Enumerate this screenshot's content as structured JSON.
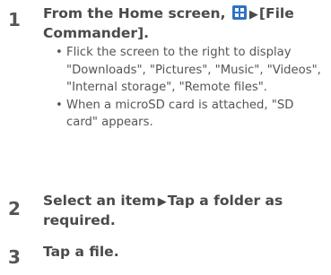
{
  "steps": [
    {
      "number": "1",
      "text_before": "From the Home screen,",
      "text_after": "[File Commander].",
      "icon": "apps-grid-icon",
      "arrow": "▶",
      "bullets": [
        "Flick the screen to the right to display \"Downloads\", \"Pictures\", \"Music\", \"Videos\", \"Internal storage\", \"Remote files\".",
        "When a microSD card is attached, \"SD card\" appears."
      ]
    },
    {
      "number": "2",
      "text_before": "Select an item",
      "arrow": "▶",
      "text_after": "Tap a folder as required."
    },
    {
      "number": "3",
      "text": "Tap a file."
    }
  ],
  "colors": {
    "text": "#4a4a4a",
    "icon_fill": "#2f73c4"
  }
}
